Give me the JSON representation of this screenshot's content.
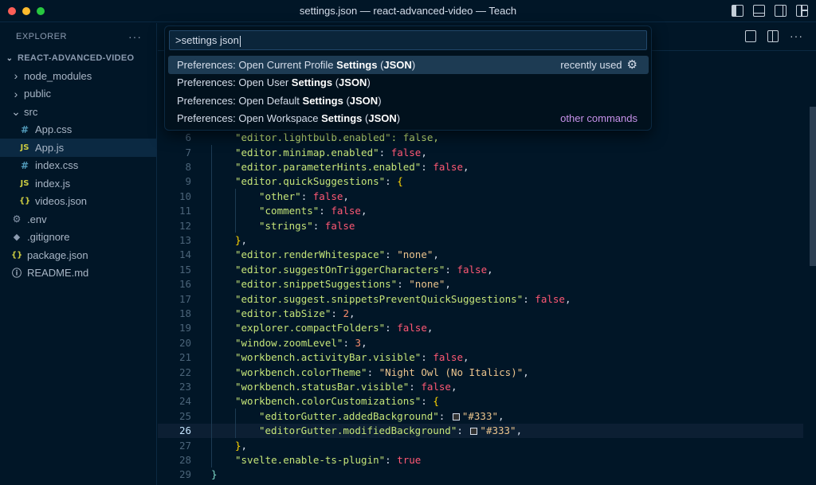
{
  "window": {
    "title": "settings.json — react-advanced-video — Teach",
    "traffic_colors": [
      "#ff5f57",
      "#febc2e",
      "#28c840"
    ]
  },
  "sidebar": {
    "header": "EXPLORER",
    "more": "···",
    "project": "REACT-ADVANCED-VIDEO",
    "items": [
      {
        "label": "node_modules",
        "icon": "chevron-right-icon",
        "glyph": "›",
        "depth": 1
      },
      {
        "label": "public",
        "icon": "chevron-right-icon",
        "glyph": "›",
        "depth": 1
      },
      {
        "label": "src",
        "icon": "chevron-down-icon",
        "glyph": "⌄",
        "depth": 1
      },
      {
        "label": "App.css",
        "icon": "css-file-icon",
        "glyph": "#",
        "depth": 2
      },
      {
        "label": "App.js",
        "icon": "js-file-icon",
        "glyph": "JS",
        "depth": 2,
        "active": true
      },
      {
        "label": "index.css",
        "icon": "css-file-icon",
        "glyph": "#",
        "depth": 2
      },
      {
        "label": "index.js",
        "icon": "js-file-icon",
        "glyph": "JS",
        "depth": 2
      },
      {
        "label": "videos.json",
        "icon": "json-file-icon",
        "glyph": "{}",
        "depth": 2
      },
      {
        "label": ".env",
        "icon": "gear-file-icon",
        "glyph": "⚙",
        "depth": 1
      },
      {
        "label": ".gitignore",
        "icon": "git-file-icon",
        "glyph": "◆",
        "depth": 1
      },
      {
        "label": "package.json",
        "icon": "json-file-icon",
        "glyph": "{}",
        "depth": 1
      },
      {
        "label": "README.md",
        "icon": "info-file-icon",
        "glyph": "ⓘ",
        "depth": 1
      }
    ]
  },
  "editor": {
    "more": "···",
    "current_line": 26
  },
  "palette": {
    "query": ">settings json",
    "items": [
      {
        "prefix": "Preferences: Open Current Profile ",
        "bold": "Settings",
        "mid": " (",
        "bold2": "JSON",
        "suffix": ")",
        "right": "recently used",
        "selected": true
      },
      {
        "prefix": "Preferences: Open User ",
        "bold": "Settings",
        "mid": " (",
        "bold2": "JSON",
        "suffix": ")",
        "right": ""
      },
      {
        "prefix": "Preferences: Open Default ",
        "bold": "Settings",
        "mid": " (",
        "bold2": "JSON",
        "suffix": ")",
        "right": ""
      },
      {
        "prefix": "Preferences: Open Workspace ",
        "bold": "Settings",
        "mid": " (",
        "bold2": "JSON",
        "suffix": ")",
        "right": "other commands"
      }
    ]
  },
  "code": {
    "partial_line": {
      "num": "6",
      "text": "\"editor.lightbulb.enabled\": false,"
    },
    "lines": [
      {
        "num": "7",
        "tokens": [
          [
            "k",
            "\"editor.minimap.enabled\""
          ],
          [
            "pn",
            ": "
          ],
          [
            "f",
            "false"
          ],
          [
            "pn",
            ","
          ]
        ],
        "indent": 1
      },
      {
        "num": "8",
        "tokens": [
          [
            "k",
            "\"editor.parameterHints.enabled\""
          ],
          [
            "pn",
            ": "
          ],
          [
            "f",
            "false"
          ],
          [
            "pn",
            ","
          ]
        ],
        "indent": 1
      },
      {
        "num": "9",
        "tokens": [
          [
            "k",
            "\"editor.quickSuggestions\""
          ],
          [
            "pn",
            ": "
          ],
          [
            "brace-y",
            "{"
          ]
        ],
        "indent": 1
      },
      {
        "num": "10",
        "tokens": [
          [
            "k",
            "\"other\""
          ],
          [
            "pn",
            ": "
          ],
          [
            "f",
            "false"
          ],
          [
            "pn",
            ","
          ]
        ],
        "indent": 2
      },
      {
        "num": "11",
        "tokens": [
          [
            "k",
            "\"comments\""
          ],
          [
            "pn",
            ": "
          ],
          [
            "f",
            "false"
          ],
          [
            "pn",
            ","
          ]
        ],
        "indent": 2
      },
      {
        "num": "12",
        "tokens": [
          [
            "k",
            "\"strings\""
          ],
          [
            "pn",
            ": "
          ],
          [
            "f",
            "false"
          ]
        ],
        "indent": 2
      },
      {
        "num": "13",
        "tokens": [
          [
            "brace-y",
            "}"
          ],
          [
            "pn",
            ","
          ]
        ],
        "indent": 1
      },
      {
        "num": "14",
        "tokens": [
          [
            "k",
            "\"editor.renderWhitespace\""
          ],
          [
            "pn",
            ": "
          ],
          [
            "s",
            "\"none\""
          ],
          [
            "pn",
            ","
          ]
        ],
        "indent": 1
      },
      {
        "num": "15",
        "tokens": [
          [
            "k",
            "\"editor.suggestOnTriggerCharacters\""
          ],
          [
            "pn",
            ": "
          ],
          [
            "f",
            "false"
          ],
          [
            "pn",
            ","
          ]
        ],
        "indent": 1
      },
      {
        "num": "16",
        "tokens": [
          [
            "k",
            "\"editor.snippetSuggestions\""
          ],
          [
            "pn",
            ": "
          ],
          [
            "s",
            "\"none\""
          ],
          [
            "pn",
            ","
          ]
        ],
        "indent": 1
      },
      {
        "num": "17",
        "tokens": [
          [
            "k",
            "\"editor.suggest.snippetsPreventQuickSuggestions\""
          ],
          [
            "pn",
            ": "
          ],
          [
            "f",
            "false"
          ],
          [
            "pn",
            ","
          ]
        ],
        "indent": 1
      },
      {
        "num": "18",
        "tokens": [
          [
            "k",
            "\"editor.tabSize\""
          ],
          [
            "pn",
            ": "
          ],
          [
            "num",
            "2"
          ],
          [
            "pn",
            ","
          ]
        ],
        "indent": 1
      },
      {
        "num": "19",
        "tokens": [
          [
            "k",
            "\"explorer.compactFolders\""
          ],
          [
            "pn",
            ": "
          ],
          [
            "f",
            "false"
          ],
          [
            "pn",
            ","
          ]
        ],
        "indent": 1
      },
      {
        "num": "20",
        "tokens": [
          [
            "k",
            "\"window.zoomLevel\""
          ],
          [
            "pn",
            ": "
          ],
          [
            "num",
            "3"
          ],
          [
            "pn",
            ","
          ]
        ],
        "indent": 1
      },
      {
        "num": "21",
        "tokens": [
          [
            "k",
            "\"workbench.activityBar.visible\""
          ],
          [
            "pn",
            ": "
          ],
          [
            "f",
            "false"
          ],
          [
            "pn",
            ","
          ]
        ],
        "indent": 1
      },
      {
        "num": "22",
        "tokens": [
          [
            "k",
            "\"workbench.colorTheme\""
          ],
          [
            "pn",
            ": "
          ],
          [
            "s",
            "\"Night Owl (No Italics)\""
          ],
          [
            "pn",
            ","
          ]
        ],
        "indent": 1
      },
      {
        "num": "23",
        "tokens": [
          [
            "k",
            "\"workbench.statusBar.visible\""
          ],
          [
            "pn",
            ": "
          ],
          [
            "f",
            "false"
          ],
          [
            "pn",
            ","
          ]
        ],
        "indent": 1
      },
      {
        "num": "24",
        "tokens": [
          [
            "k",
            "\"workbench.colorCustomizations\""
          ],
          [
            "pn",
            ": "
          ],
          [
            "brace-y",
            "{"
          ]
        ],
        "indent": 1
      },
      {
        "num": "25",
        "tokens": [
          [
            "k",
            "\"editorGutter.addedBackground\""
          ],
          [
            "pn",
            ": "
          ],
          [
            "swatch",
            ""
          ],
          [
            "s",
            "\"#333\""
          ],
          [
            "pn",
            ","
          ]
        ],
        "indent": 2
      },
      {
        "num": "26",
        "tokens": [
          [
            "k",
            "\"editorGutter.modifiedBackground\""
          ],
          [
            "pn",
            ": "
          ],
          [
            "swatch",
            ""
          ],
          [
            "s",
            "\"#333\""
          ],
          [
            "pn",
            ","
          ]
        ],
        "indent": 2
      },
      {
        "num": "27",
        "tokens": [
          [
            "brace-y",
            "}"
          ],
          [
            "pn",
            ","
          ]
        ],
        "indent": 1
      },
      {
        "num": "28",
        "tokens": [
          [
            "k",
            "\"svelte.enable-ts-plugin\""
          ],
          [
            "pn",
            ": "
          ],
          [
            "t",
            "true"
          ]
        ],
        "indent": 1
      },
      {
        "num": "29",
        "tokens": [
          [
            "br",
            "}"
          ]
        ],
        "indent": 0
      }
    ]
  }
}
